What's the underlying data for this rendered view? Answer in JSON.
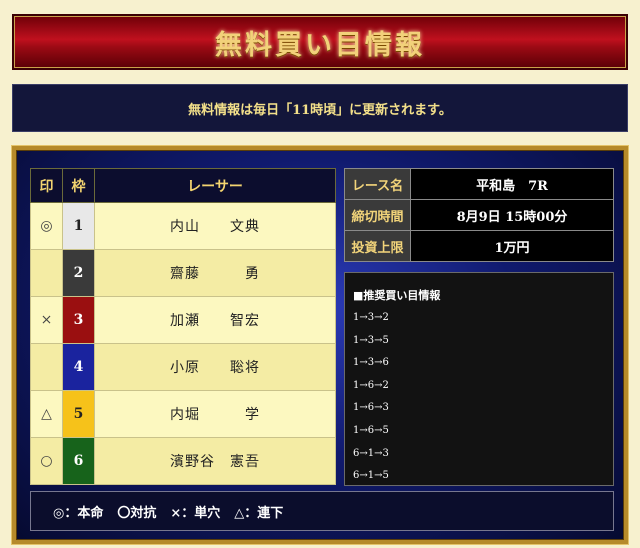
{
  "header": {
    "title": "無料買い目情報"
  },
  "notice": {
    "text": "無料情報は毎日「11時頃」に更新されます。"
  },
  "racer_table": {
    "headers": {
      "mark": "印",
      "waku": "枠",
      "racer": "レーサー"
    },
    "rows": [
      {
        "mark": "◎",
        "waku": "1",
        "name": "内山　　文典",
        "waku_bg": "#e8e8e8",
        "waku_fg": "#222222"
      },
      {
        "mark": "",
        "waku": "2",
        "name": "齋藤　　　勇",
        "waku_bg": "#3a3a3a",
        "waku_fg": "#ffffff"
      },
      {
        "mark": "×",
        "waku": "3",
        "name": "加瀬　　智宏",
        "waku_bg": "#9a0f10",
        "waku_fg": "#ffffff"
      },
      {
        "mark": "",
        "waku": "4",
        "name": "小原　　聡将",
        "waku_bg": "#1a239e",
        "waku_fg": "#ffffff"
      },
      {
        "mark": "△",
        "waku": "5",
        "name": "内堀　　　学",
        "waku_bg": "#f6c21a",
        "waku_fg": "#222222"
      },
      {
        "mark": "○",
        "waku": "6",
        "name": "濱野谷　憲吾",
        "waku_bg": "#17631b",
        "waku_fg": "#ffffff"
      }
    ]
  },
  "race_info": {
    "rows": [
      {
        "label": "レース名",
        "value": "平和島　7R"
      },
      {
        "label": "締切時間",
        "value": "8月9日 15時00分"
      },
      {
        "label": "投資上限",
        "value": "1万円"
      }
    ]
  },
  "tips": {
    "title": "■推奨買い目情報",
    "lines": [
      "1→3→2",
      "1→3→5",
      "1→3→6",
      "1→6→2",
      "1→6→3",
      "1→6→5",
      "6→1→3",
      "6→1→5"
    ]
  },
  "legend": {
    "items": [
      "◎：本命",
      "〇対抗",
      "×：単穴",
      "△：連下"
    ]
  }
}
